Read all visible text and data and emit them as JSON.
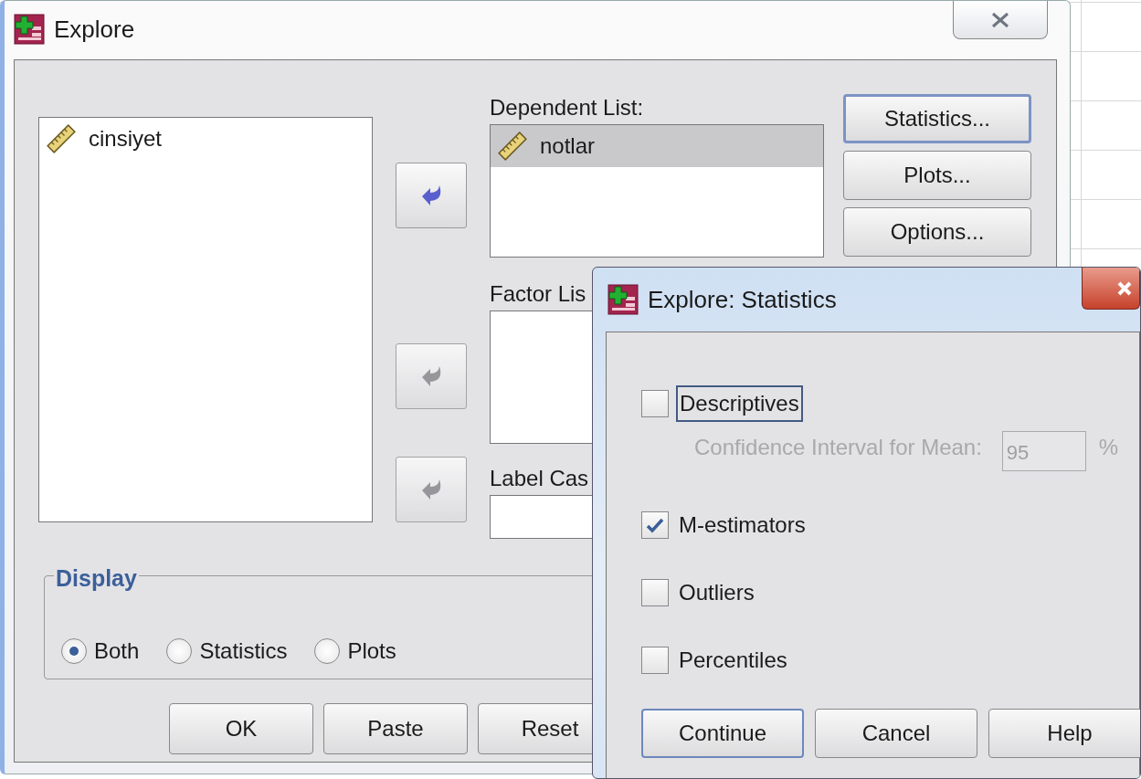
{
  "main_window": {
    "title": "Explore",
    "source_list": {
      "items": [
        {
          "label": "cinsiyet",
          "selected": false
        }
      ]
    },
    "move_buttons": [
      {
        "disabled": false
      },
      {
        "disabled": true
      },
      {
        "disabled": true
      }
    ],
    "dependent_list": {
      "label": "Dependent List:",
      "items": [
        {
          "label": "notlar",
          "selected": true
        }
      ]
    },
    "factor_list": {
      "label": "Factor Lis"
    },
    "label_cases": {
      "label": "Label Cas"
    },
    "side_buttons": [
      {
        "label": "Statistics...",
        "focused": true
      },
      {
        "label": "Plots...",
        "focused": false
      },
      {
        "label": "Options...",
        "focused": false
      }
    ],
    "display": {
      "legend": "Display",
      "options": [
        {
          "label": "Both",
          "selected": true
        },
        {
          "label": "Statistics",
          "selected": false
        },
        {
          "label": "Plots",
          "selected": false
        }
      ]
    },
    "buttons": [
      {
        "label": "OK"
      },
      {
        "label": "Paste"
      },
      {
        "label": "Reset"
      }
    ]
  },
  "statistics_dialog": {
    "title": "Explore: Statistics",
    "options": [
      {
        "label": "Descriptives",
        "checked": false,
        "focused": true,
        "sub": {
          "label": "Confidence Interval for Mean:",
          "value": "95",
          "unit": "%",
          "disabled": true
        }
      },
      {
        "label": "M-estimators",
        "checked": true,
        "focused": false
      },
      {
        "label": "Outliers",
        "checked": false,
        "focused": false
      },
      {
        "label": "Percentiles",
        "checked": false,
        "focused": false
      }
    ],
    "buttons": [
      {
        "label": "Continue",
        "focused": true
      },
      {
        "label": "Cancel",
        "focused": false
      },
      {
        "label": "Help",
        "focused": false
      }
    ]
  }
}
